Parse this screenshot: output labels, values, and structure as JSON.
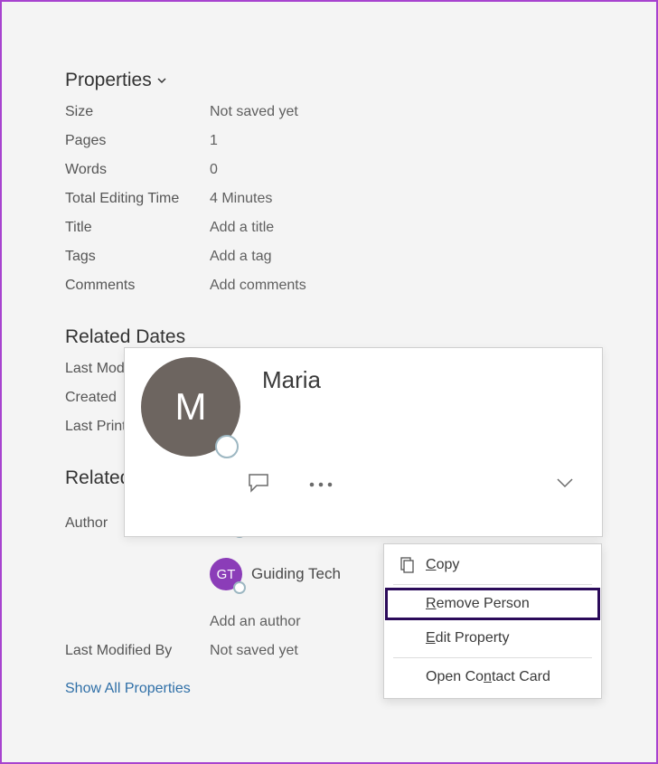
{
  "properties_header": "Properties",
  "rows": {
    "size_label": "Size",
    "size_value": "Not saved yet",
    "pages_label": "Pages",
    "pages_value": "1",
    "words_label": "Words",
    "words_value": "0",
    "tet_label": "Total Editing Time",
    "tet_value": "4 Minutes",
    "title_label": "Title",
    "title_placeholder": "Add a title",
    "tags_label": "Tags",
    "tags_placeholder": "Add a tag",
    "comments_label": "Comments",
    "comments_placeholder": "Add comments"
  },
  "related_dates_header": "Related Dates",
  "dates": {
    "last_modified_label": "Last Modified",
    "created_label": "Created",
    "last_printed_label": "Last Printed"
  },
  "related_people_header": "Related People",
  "people": {
    "author_label": "Author",
    "author1_initial": "M",
    "author1_name": "Maria",
    "author2_initial": "GT",
    "author2_name": "Guiding Tech",
    "add_author_placeholder": "Add an author",
    "last_modified_by_label": "Last Modified By",
    "last_modified_by_value": "Not saved yet"
  },
  "show_all_link": "Show All Properties",
  "contact_card": {
    "avatar_initial": "M",
    "name": "Maria"
  },
  "context_menu": {
    "copy_prefix": "C",
    "copy_rest": "opy",
    "remove_prefix": "R",
    "remove_rest": "emove Person",
    "edit_prefix": "E",
    "edit_rest": "dit Property",
    "open_prefix": "Open Co",
    "open_mn": "n",
    "open_rest": "tact Card"
  }
}
